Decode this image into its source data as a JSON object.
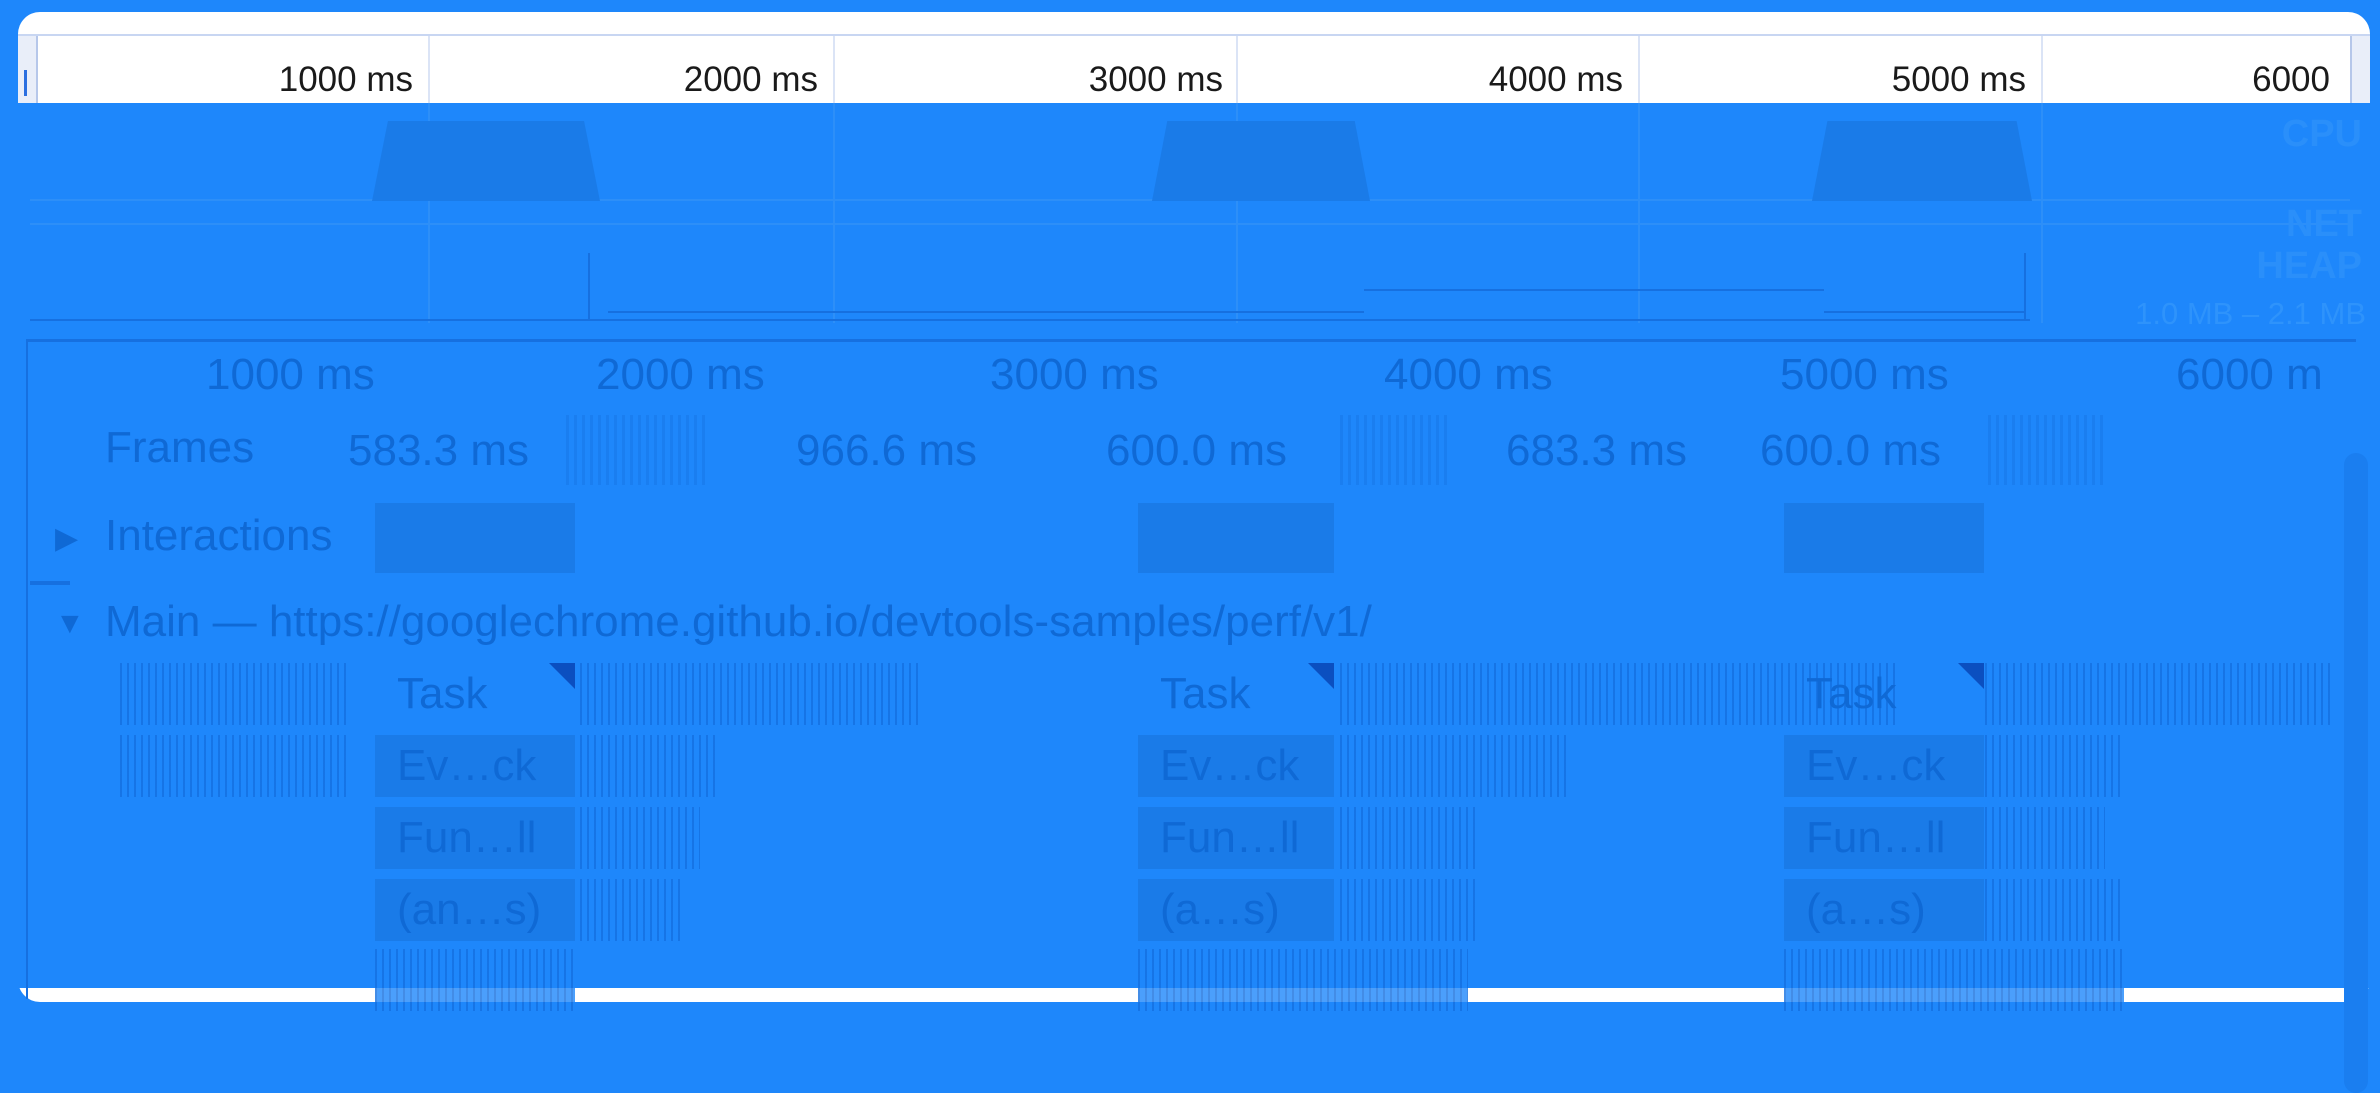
{
  "overview": {
    "ticks": [
      "1000 ms",
      "2000 ms",
      "3000 ms",
      "4000 ms",
      "5000 ms",
      "6000"
    ],
    "labels": {
      "cpu": "CPU",
      "net": "NET",
      "heap": "HEAP"
    },
    "heap_range": "1.0 MB – 2.1 MB"
  },
  "timeline": {
    "ticks": [
      "1000 ms",
      "2000 ms",
      "3000 ms",
      "4000 ms",
      "5000 ms",
      "6000 m"
    ],
    "frames": {
      "label": "Frames",
      "durations": [
        "583.3 ms",
        "966.6 ms",
        "600.0 ms",
        "683.3 ms",
        "600.0 ms"
      ]
    },
    "interactions": {
      "label": "Interactions"
    },
    "main": {
      "label": "Main — https://googlechrome.github.io/devtools-samples/perf/v1/",
      "groups": [
        {
          "task": "Task",
          "event": "Ev…ck",
          "func": "Fun…ll",
          "anon": "(an…s)"
        },
        {
          "task": "Task",
          "event": "Ev…ck",
          "func": "Fun…ll",
          "anon": "(a…s)"
        },
        {
          "task": "Task",
          "event": "Ev…ck",
          "func": "Fun…ll",
          "anon": "(a…s)"
        }
      ]
    }
  },
  "colors": {
    "overlay": "#1e87fb",
    "selection": "#f5cbc8",
    "marker": "#e0322b"
  }
}
